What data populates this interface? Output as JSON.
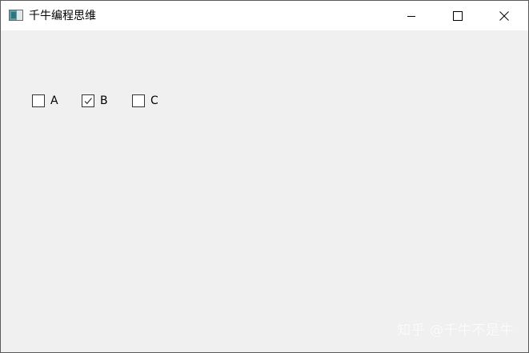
{
  "window": {
    "title": "千牛编程思维",
    "app_icon": "app-window-icon",
    "controls": {
      "minimize_icon": "minimize-icon",
      "maximize_icon": "maximize-icon",
      "close_icon": "close-icon"
    }
  },
  "checkboxes": [
    {
      "label": "A",
      "checked": false
    },
    {
      "label": "B",
      "checked": true
    },
    {
      "label": "C",
      "checked": false
    }
  ],
  "watermark": {
    "text": "知乎 @千牛不是牛"
  },
  "colors": {
    "titlebar": "#ffffff",
    "client_area": "#f0f0f0",
    "window_border": "#5a5a5a",
    "checkbox_border": "#333333",
    "checkmark": "#333333"
  }
}
